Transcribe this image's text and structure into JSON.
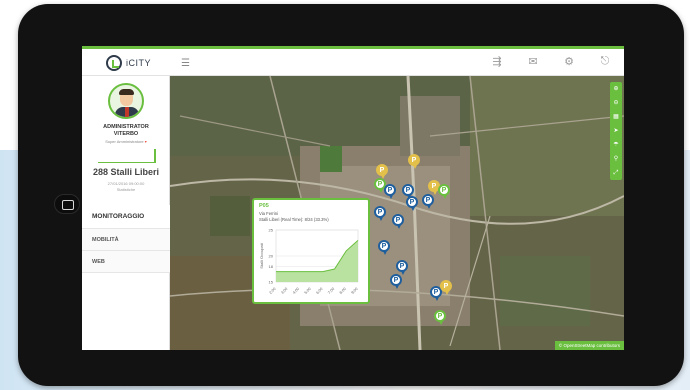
{
  "brand": {
    "logo_text": "iCITY",
    "accent": "#6abf3f",
    "dark": "#2f3b4a"
  },
  "topbar": {
    "menu_icon": "hamburger-icon",
    "icons": [
      "traffic-icon",
      "mail-icon",
      "gear-icon",
      "logout-icon"
    ]
  },
  "user": {
    "name_line1": "ADMINISTRATOR",
    "name_line2": "VITERBO",
    "role": "Super Amministratore",
    "role_caret": "▾"
  },
  "summary": {
    "free_spots": "288 Stalli Liberi",
    "datetime": "27/01/2016 09:00:00",
    "note": "Statistiche"
  },
  "nav": [
    "MONITORAGGIO",
    "MOBILITÀ",
    "WEB"
  ],
  "map": {
    "tools": [
      "plus-icon",
      "minus-icon",
      "layers-icon",
      "locate-icon",
      "umbrella-icon",
      "pin-icon",
      "expand-icon"
    ],
    "attribution": "© OpenStreetMap contributors",
    "pin_label": "P"
  },
  "popup": {
    "title": "P05",
    "address": "Via Ferrini",
    "stat": "Stalli Liberi (Real Time): 8/24 (33.3%)",
    "chart_data": {
      "type": "area",
      "ylabel": "Stalli Occupati",
      "ylim": [
        15,
        25
      ],
      "yticks": [
        15,
        18,
        20,
        25
      ],
      "x": [
        "2:00",
        "3:00",
        "4:00",
        "5:00",
        "6:00",
        "7:00",
        "8:00",
        "9:00"
      ],
      "values": [
        17,
        17,
        17,
        17,
        17,
        17.5,
        21,
        23
      ]
    }
  }
}
